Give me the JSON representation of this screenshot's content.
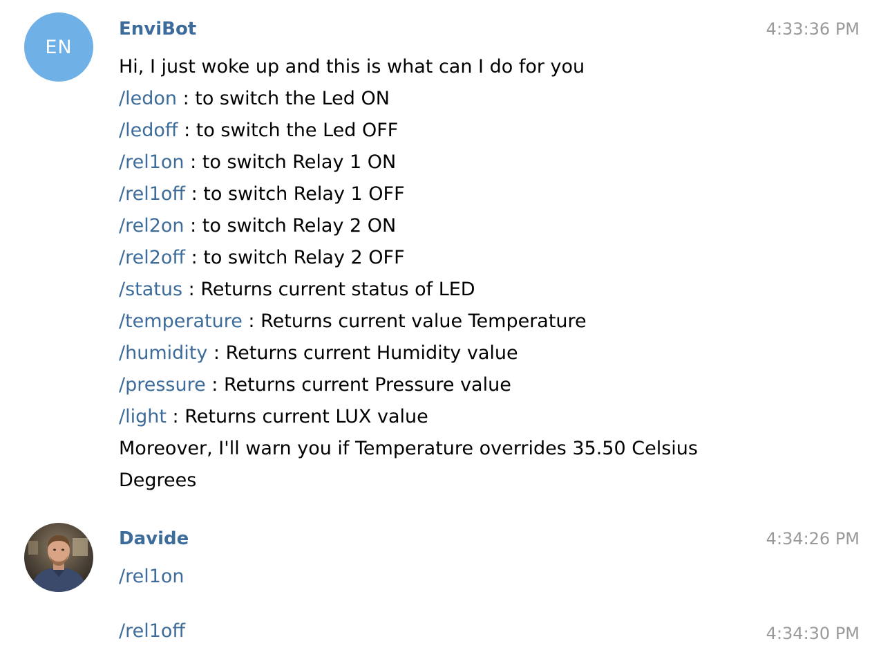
{
  "bot_message": {
    "avatar_initials": "EN",
    "sender": "EnviBot",
    "time": "4:33:36 PM",
    "intro": "Hi, I just woke up and this is what can I do for you",
    "commands": [
      {
        "cmd": "/ledon",
        "desc": " : to switch the Led ON"
      },
      {
        "cmd": "/ledoff",
        "desc": " : to switch the Led OFF"
      },
      {
        "cmd": "/rel1on",
        "desc": " : to switch Relay 1 ON"
      },
      {
        "cmd": "/rel1off",
        "desc": " : to switch Relay 1 OFF"
      },
      {
        "cmd": "/rel2on",
        "desc": " : to switch Relay 2 ON"
      },
      {
        "cmd": "/rel2off",
        "desc": " : to switch Relay 2 OFF"
      },
      {
        "cmd": "/status",
        "desc": " : Returns current status of LED"
      },
      {
        "cmd": "/temperature",
        "desc": " : Returns current value Temperature"
      },
      {
        "cmd": "/humidity",
        "desc": " : Returns current Humidity value"
      },
      {
        "cmd": "/pressure",
        "desc": " : Returns current Pressure value"
      },
      {
        "cmd": "/light",
        "desc": " : Returns current LUX value"
      }
    ],
    "outro_line1": "Moreover, I'll warn you if Temperature overrides  35.50 Celsius",
    "outro_line2": "Degrees"
  },
  "user_message": {
    "sender": "Davide",
    "time": "4:34:26 PM",
    "text": "/rel1on"
  },
  "followup_message": {
    "time": "4:34:30 PM",
    "text": "/rel1off"
  },
  "colors": {
    "link": "#3d6b9a",
    "sender": "#3d6b9a",
    "timestamp": "#9a9a9a",
    "avatar_bg": "#6fb0e6"
  }
}
